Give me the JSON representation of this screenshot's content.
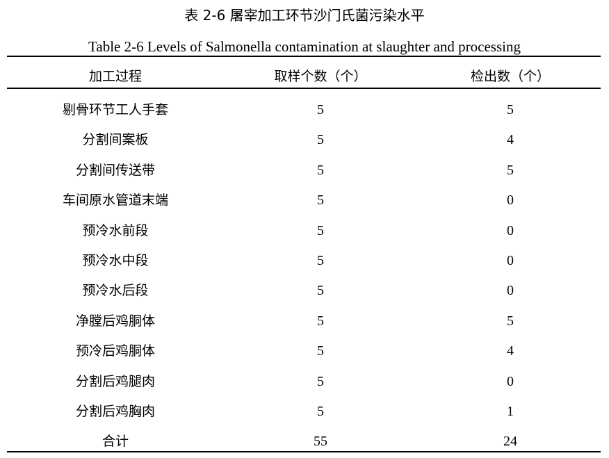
{
  "title": "表 2-6  屠宰加工环节沙门氏菌污染水平",
  "subtitle": "Table 2-6 Levels of Salmonella contamination at slaughter and processing",
  "columns": [
    "加工过程",
    "取样个数（个）",
    "检出数（个）"
  ],
  "rows": [
    [
      "剔骨环节工人手套",
      "5",
      "5"
    ],
    [
      "分割间案板",
      "5",
      "4"
    ],
    [
      "分割间传送带",
      "5",
      "5"
    ],
    [
      "车间原水管道末端",
      "5",
      "0"
    ],
    [
      "预冷水前段",
      "5",
      "0"
    ],
    [
      "预冷水中段",
      "5",
      "0"
    ],
    [
      "预冷水后段",
      "5",
      "0"
    ],
    [
      "净膛后鸡胴体",
      "5",
      "5"
    ],
    [
      "预冷后鸡胴体",
      "5",
      "4"
    ],
    [
      "分割后鸡腿肉",
      "5",
      "0"
    ],
    [
      "分割后鸡胸肉",
      "5",
      "1"
    ],
    [
      "合计",
      "55",
      "24"
    ]
  ]
}
